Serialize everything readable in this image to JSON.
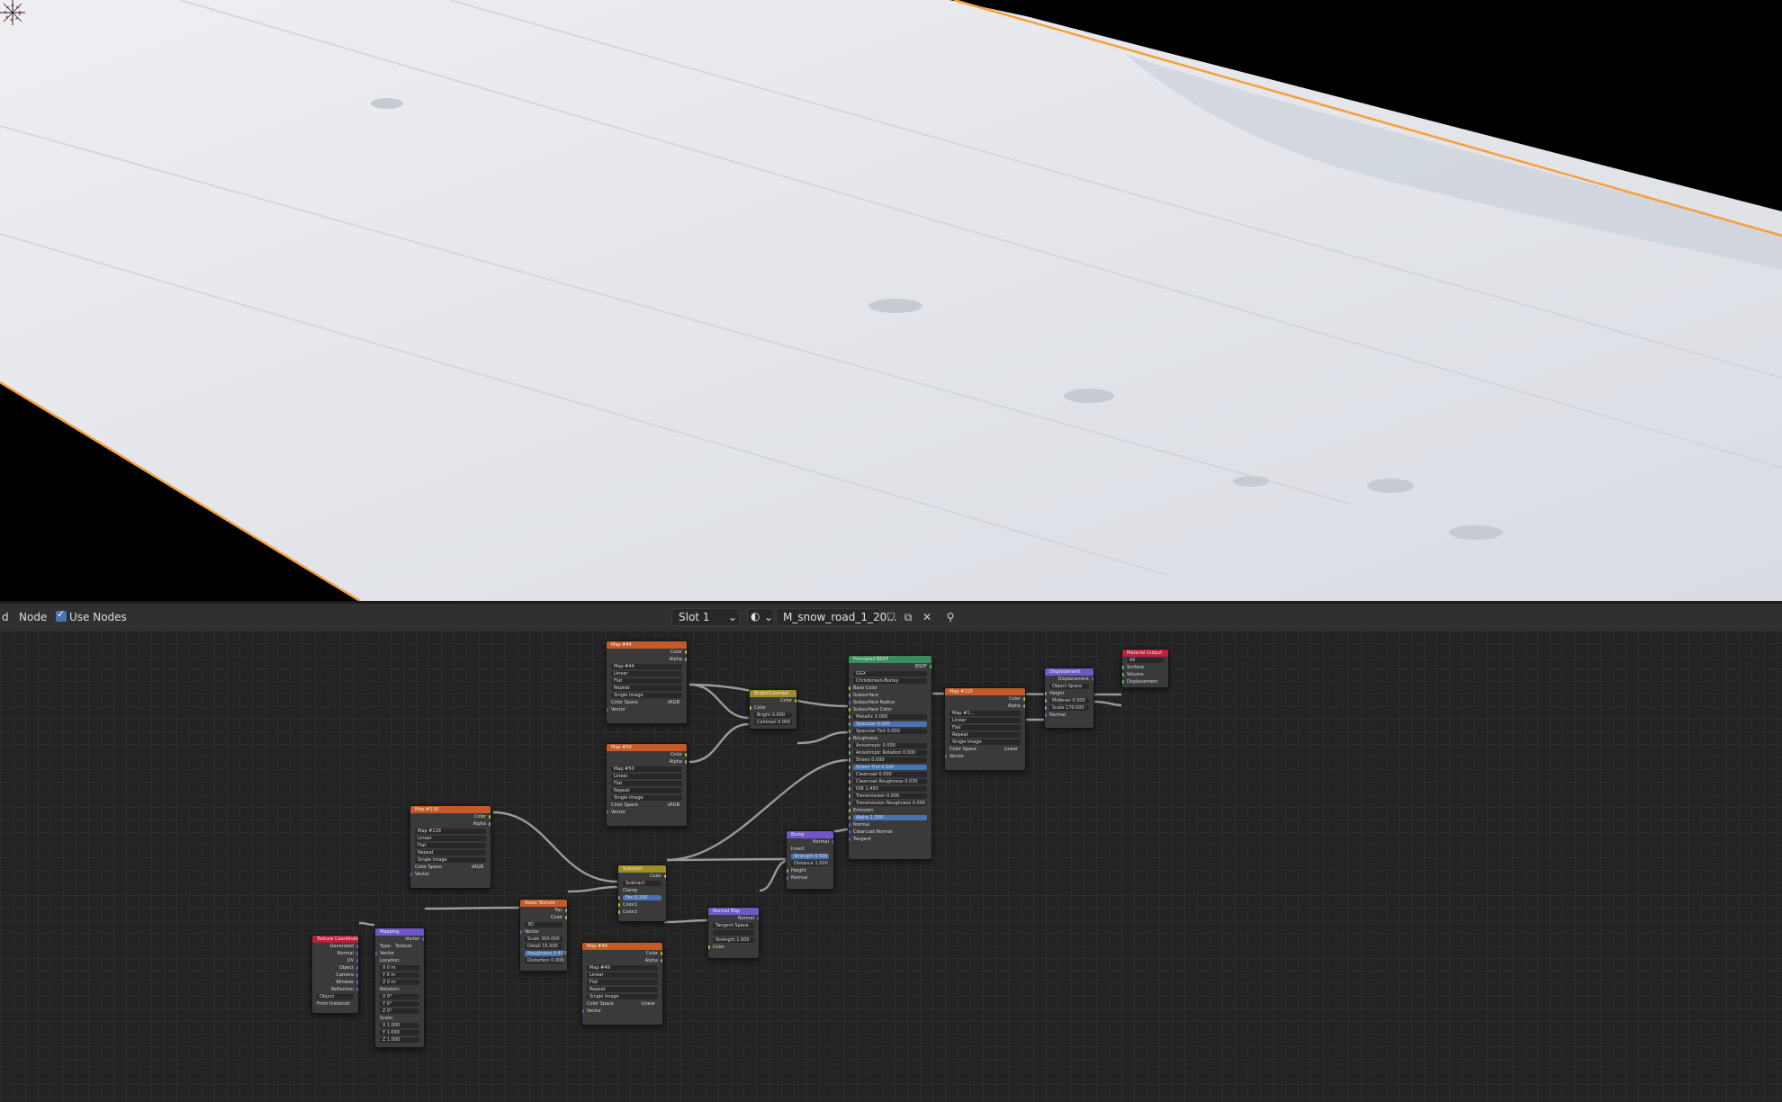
{
  "header": {
    "left_clip": "d",
    "node_menu": "Node",
    "use_nodes_label": "Use Nodes",
    "use_nodes_checked": true,
    "slot": "Slot 1",
    "material_name": "M_snow_road_1_20...",
    "icons": [
      "dropdown-chevron-icon",
      "sphere-icon",
      "shield-icon",
      "duplicate-icon",
      "close-icon",
      "pin-icon"
    ]
  },
  "colors": {
    "selection_outline": "#f5a03a",
    "snow": "#e6e8ec",
    "header_bg": "#303030",
    "editor_bg": "#232323",
    "tex_header": "#c35a28",
    "vector_header": "#6f57c9",
    "shader_header": "#3a8c5c",
    "color_header": "#a08d28",
    "output_header": "#b3233a"
  },
  "nodes": {
    "texcoord": {
      "title": "Texture Coordinate",
      "outputs": [
        "Generated",
        "Normal",
        "UV",
        "Object",
        "Camera",
        "Window",
        "Reflection"
      ],
      "object_label": "Object",
      "from_instancer": "From Instancer"
    },
    "mapping": {
      "title": "Mapping",
      "output": "Vector",
      "type_label": "Type:",
      "type_value": "Texture",
      "vector": "Vector",
      "location": "Location:",
      "loc": [
        "X   0 m",
        "Y   0 m",
        "Z   0 m"
      ],
      "rotation": "Rotation:",
      "rot": [
        "X   0°",
        "Y   0°",
        "Z   0°"
      ],
      "scale": "Scale:",
      "scl": [
        "X   1.000",
        "Y   1.000",
        "Z   1.000"
      ]
    },
    "noise": {
      "title": "Noise Texture",
      "outputs": [
        "Fac",
        "Color"
      ],
      "dim": "3D",
      "vector": "Vector",
      "fields": [
        "Scale   300.000",
        "Detail   15.000",
        "Roughness   0.433",
        "Distortion   0.000"
      ]
    },
    "img118": {
      "title": "Map #118",
      "outputs": [
        "Color",
        "Alpha"
      ],
      "image": "Map #118",
      "opts": [
        "Linear",
        "Flat",
        "Repeat",
        "Single Image"
      ],
      "colorspace_label": "Color Space",
      "colorspace": "sRGB",
      "vector": "Vector"
    },
    "img44": {
      "title": "Map #44",
      "outputs": [
        "Color",
        "Alpha"
      ],
      "image": "Map #44",
      "opts": [
        "Linear",
        "Flat",
        "Repeat",
        "Single Image"
      ],
      "colorspace_label": "Color Space",
      "colorspace": "sRGB",
      "vector": "Vector"
    },
    "img50": {
      "title": "Map #50",
      "outputs": [
        "Color",
        "Alpha"
      ],
      "image": "Map #50",
      "opts": [
        "Linear",
        "Flat",
        "Repeat",
        "Single Image"
      ],
      "colorspace_label": "Color Space",
      "colorspace": "sRGB",
      "vector": "Vector"
    },
    "img49": {
      "title": "Map #49",
      "outputs": [
        "Color",
        "Alpha"
      ],
      "image": "Map #49",
      "opts": [
        "Linear",
        "Flat",
        "Repeat",
        "Single Image"
      ],
      "colorspace_label": "Color Space",
      "colorspace": "Linear",
      "vector": "Vector"
    },
    "img115": {
      "title": "Map #115",
      "outputs": [
        "Color",
        "Alpha"
      ],
      "image": "Map #1...",
      "opts": [
        "Linear",
        "Flat",
        "Repeat",
        "Single Image"
      ],
      "colorspace_label": "Color Space",
      "colorspace": "Linear",
      "vector": "Vector"
    },
    "brightcontrast": {
      "title": "Bright/Contrast",
      "output": "Color",
      "color": "Color",
      "bright": "Bright   0.000",
      "contrast": "Contrast   0.000"
    },
    "subtract": {
      "title": "Subtract",
      "output": "Color",
      "mode": "Subtract",
      "clamp": "Clamp",
      "fac": "Fac   0.100",
      "inputs": [
        "Color1",
        "Color2"
      ]
    },
    "bump": {
      "title": "Bump",
      "output": "Normal",
      "invert": "Invert",
      "strength": "Strength   0.500",
      "distance": "Distance   1.000",
      "inputs": [
        "Height",
        "Normal"
      ]
    },
    "normalmap": {
      "title": "Normal Map",
      "output": "Normal",
      "space": "Tangent Space",
      "strength": "Strength   1.000",
      "color": "Color"
    },
    "principled": {
      "title": "Principled BSDF",
      "output": "BSDF",
      "dist": "GGX",
      "sss": "Christensen-Burley",
      "rows": [
        "Base Color",
        "Subsurface",
        "Subsurface Radius",
        "Subsurface Color",
        "Metallic   0.000",
        "Specular   0.500",
        "Specular Tint   0.000",
        "Roughness",
        "Anisotropic   0.000",
        "Anisotropic Rotation   0.000",
        "Sheen   0.000",
        "Sheen Tint   0.500",
        "Clearcoat   0.000",
        "Clearcoat Roughness   0.030",
        "IOR   1.450",
        "Transmission   0.000",
        "Transmission Roughness   0.000",
        "Emission",
        "Alpha   1.000",
        "Normal",
        "Clearcoat Normal",
        "Tangent"
      ]
    },
    "displacement": {
      "title": "Displacement",
      "output": "Displacement",
      "space": "Object Space",
      "inputs": [
        "Height",
        "Midlevel   0.500",
        "Scale   170.000",
        "Normal"
      ]
    },
    "matout": {
      "title": "Material Output",
      "target": "All",
      "inputs": [
        "Surface",
        "Volume",
        "Displacement"
      ]
    }
  }
}
